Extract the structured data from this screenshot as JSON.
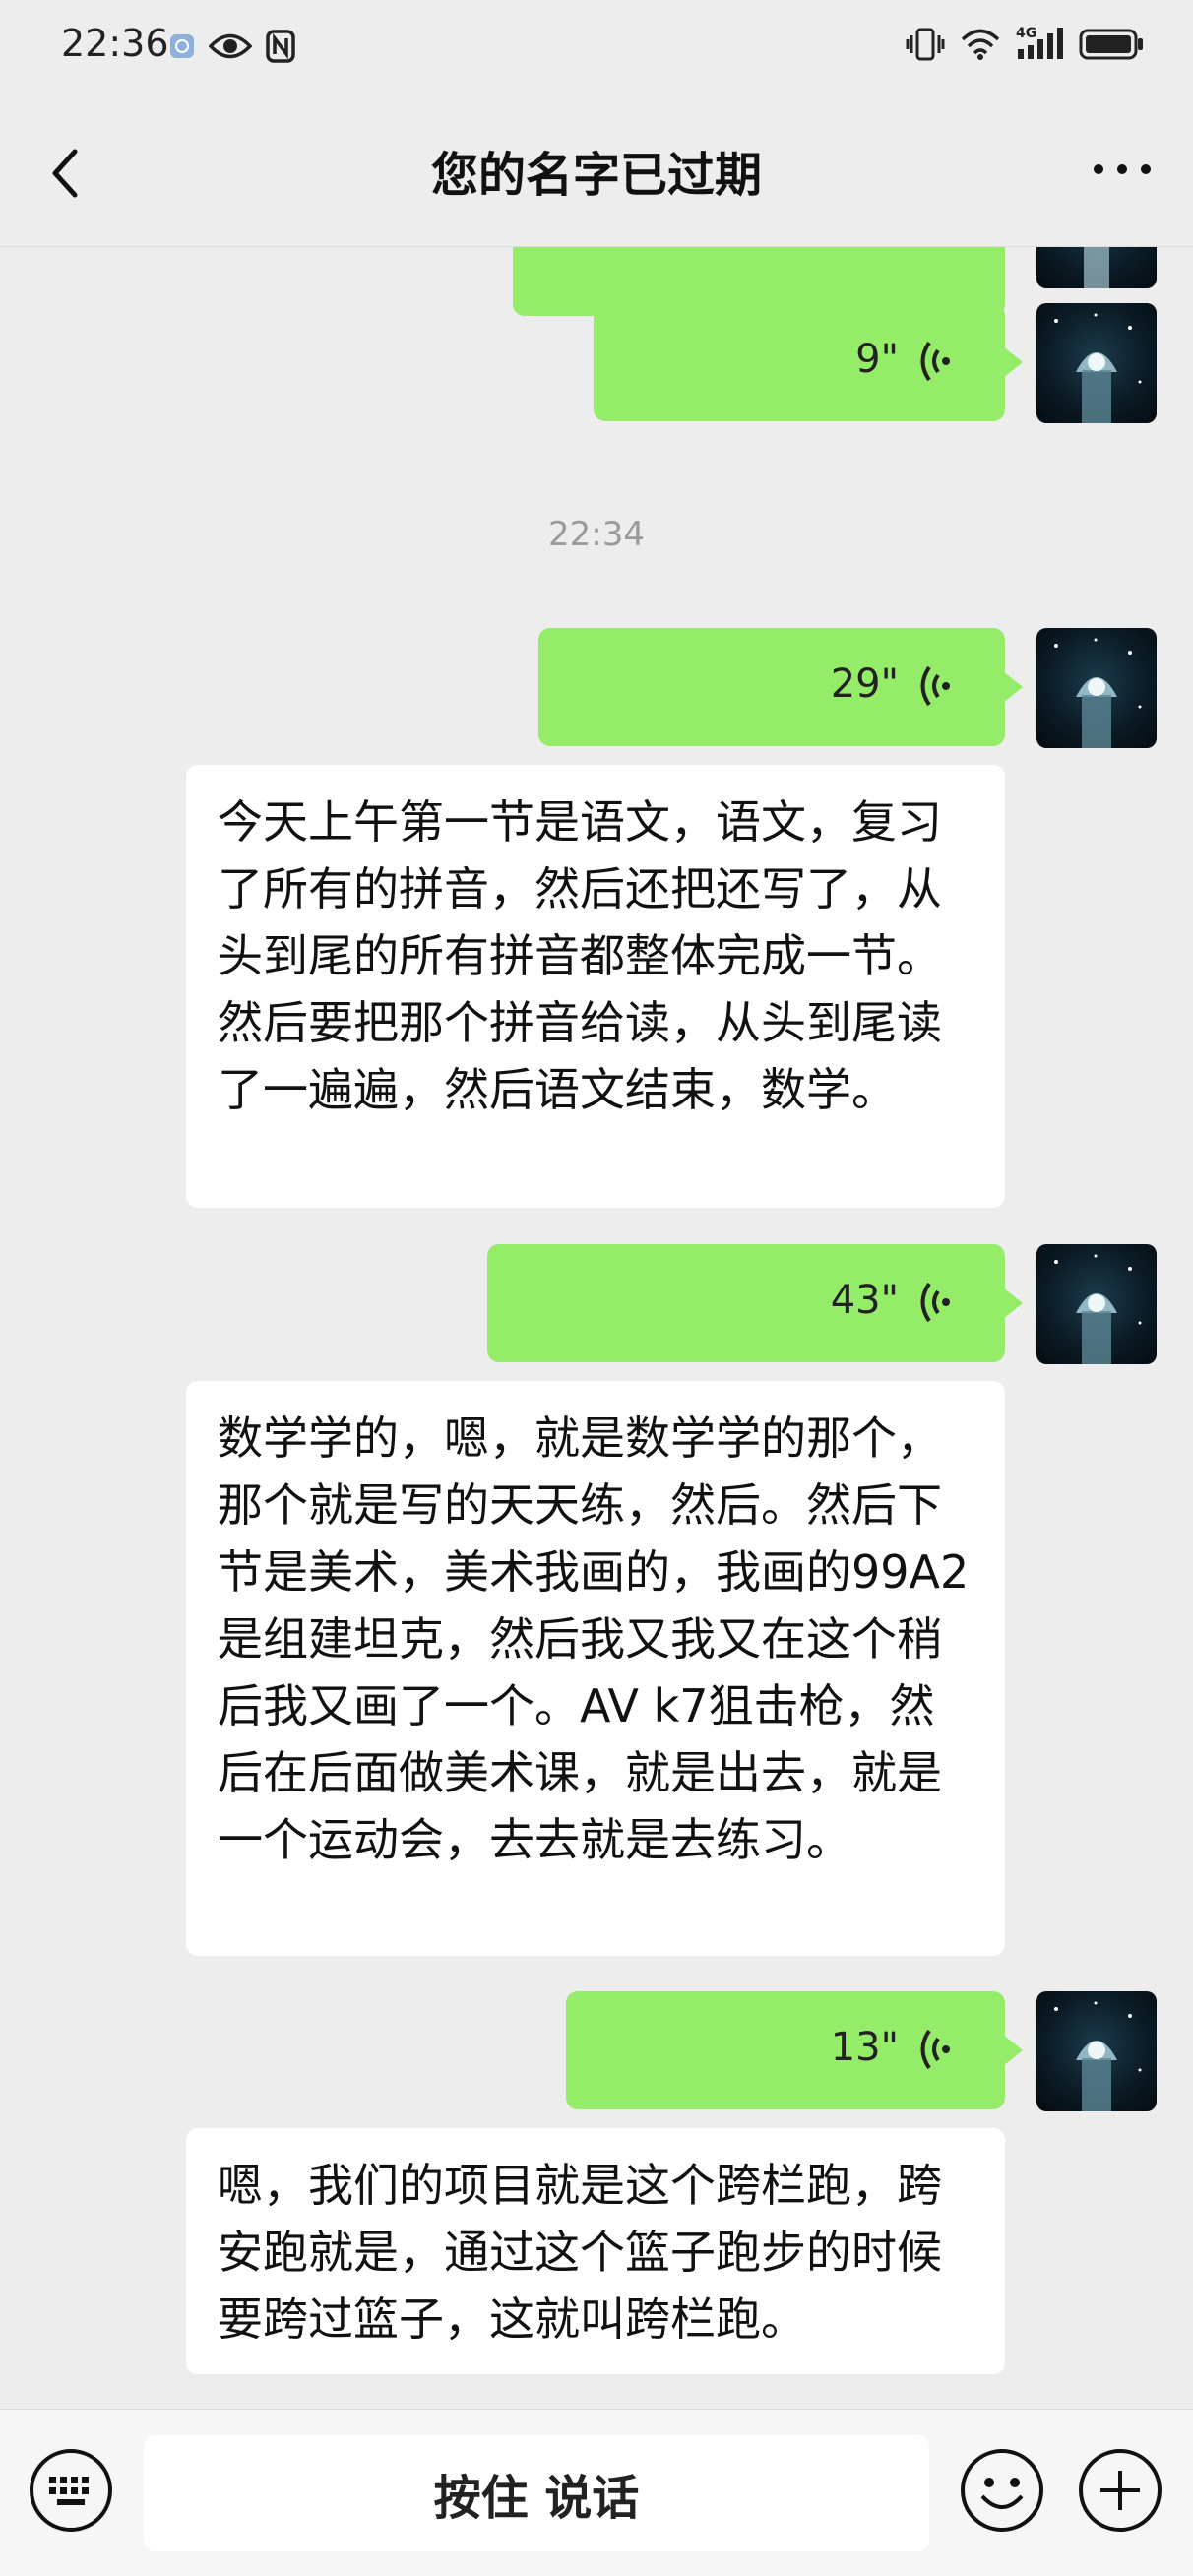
{
  "status_bar": {
    "time": "22:36",
    "icons_left": [
      "app-indicator-icon",
      "eye-icon",
      "nfc-icon"
    ],
    "icons_right": [
      "vibrate-icon",
      "wifi-icon",
      "4g-signal-icon",
      "battery-icon"
    ],
    "network_label": "4G"
  },
  "header": {
    "title": "您的名字已过期",
    "back_icon": "chevron-left-icon",
    "more_icon": "more-dots-icon"
  },
  "messages": {
    "voice_1": {
      "duration": "9\""
    },
    "timestamp_1": "22:34",
    "voice_2": {
      "duration": "29\""
    },
    "text_1": "今天上午第一节是语文，语文，复习了所有的拼音，然后还把还写了，从头到尾的所有拼音都整体完成一节。然后要把那个拼音给读，从头到尾读了一遍遍，然后语文结束，数学。",
    "voice_3": {
      "duration": "43\""
    },
    "text_2": "数学学的，嗯，就是数学学的那个，那个就是写的天天练，然后。然后下节是美术，美术我画的，我画的99A2是组建坦克，然后我又我又在这个稍后我又画了一个。AV k7狙击枪，然后在后面做美术课，就是出去，就是一个运动会，去去就是去练习。",
    "voice_4": {
      "duration": "13\""
    },
    "text_3": "嗯，我们的项目就是这个跨栏跑，跨安跑就是，通过这个篮子跑步的时候要跨过篮子，这就叫跨栏跑。"
  },
  "input_bar": {
    "hold_to_talk": "按住 说话",
    "keyboard_icon": "keyboard-icon",
    "emoji_icon": "emoji-icon",
    "plus_icon": "plus-circle-icon"
  },
  "colors": {
    "background": "#ededed",
    "voice_bubble": "#95ec69",
    "text_bubble": "#ffffff"
  }
}
